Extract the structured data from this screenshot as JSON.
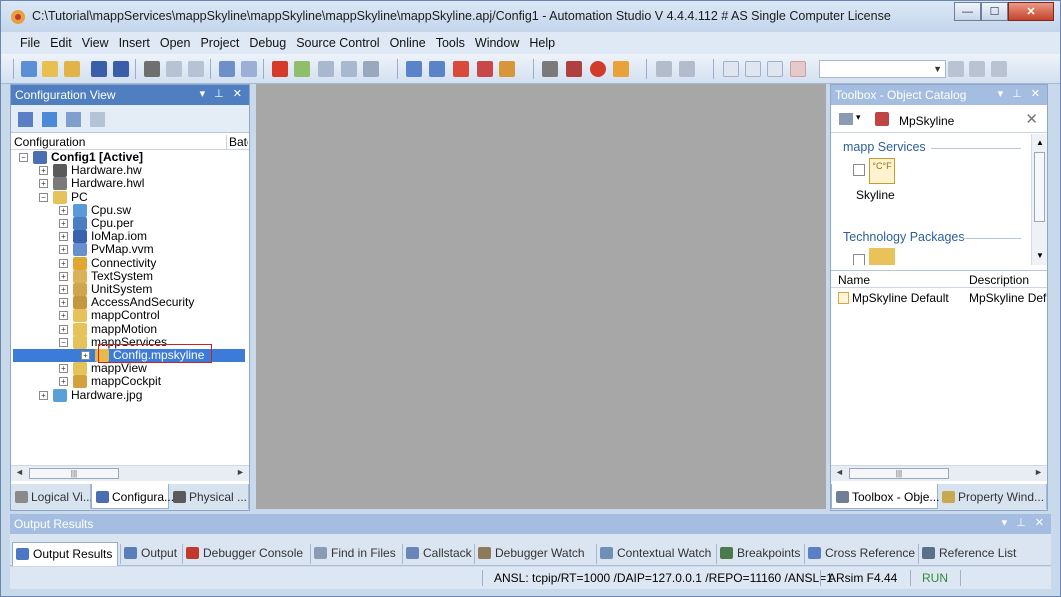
{
  "window": {
    "title": "C:\\Tutorial\\mappServices\\mappSkyline\\mappSkyline\\mappSkyline\\mappSkyline.apj/Config1 - Automation Studio V 4.4.4.112 # AS Single Computer License",
    "minimize": "—",
    "maximize": "☐",
    "close": "✕"
  },
  "menu": [
    "File",
    "Edit",
    "View",
    "Insert",
    "Open",
    "Project",
    "Debug",
    "Source Control",
    "Online",
    "Tools",
    "Window",
    "Help"
  ],
  "left_panel": {
    "title": "Configuration View",
    "title_buttons": "▾ ⊥ ✕",
    "col_configuration": "Configuration",
    "col_batch": "Batch",
    "tree": [
      {
        "label": "Config1 [Active]",
        "level": 0,
        "expander": "−",
        "bold": true,
        "icon": "config-icon",
        "color": "#4c6fb3"
      },
      {
        "label": "Hardware.hw",
        "level": 1,
        "expander": "+",
        "icon": "hardware-icon",
        "color": "#5a5a5a"
      },
      {
        "label": "Hardware.hwl",
        "level": 1,
        "expander": "+",
        "icon": "hardware-list-icon",
        "color": "#7a7a7a"
      },
      {
        "label": "PC",
        "level": 1,
        "expander": "−",
        "icon": "folder-icon",
        "color": "#e6c25a"
      },
      {
        "label": "Cpu.sw",
        "level": 2,
        "expander": "+",
        "icon": "cpu-sw-icon",
        "color": "#5a9ad8"
      },
      {
        "label": "Cpu.per",
        "level": 2,
        "expander": "+",
        "icon": "cpu-per-icon",
        "color": "#4a7fc2"
      },
      {
        "label": "IoMap.iom",
        "level": 2,
        "expander": "+",
        "icon": "iomap-icon",
        "color": "#3a62b0"
      },
      {
        "label": "PvMap.vvm",
        "level": 2,
        "expander": "+",
        "icon": "pvmap-icon",
        "color": "#6a8fcf"
      },
      {
        "label": "Connectivity",
        "level": 2,
        "expander": "+",
        "icon": "connectivity-icon",
        "color": "#e0a732"
      },
      {
        "label": "TextSystem",
        "level": 2,
        "expander": "+",
        "icon": "textsystem-icon",
        "color": "#d9b25a"
      },
      {
        "label": "UnitSystem",
        "level": 2,
        "expander": "+",
        "icon": "unitsystem-icon",
        "color": "#d2a44e"
      },
      {
        "label": "AccessAndSecurity",
        "level": 2,
        "expander": "+",
        "icon": "security-icon",
        "color": "#c8963e"
      },
      {
        "label": "mappControl",
        "level": 2,
        "expander": "+",
        "icon": "folder-icon",
        "color": "#e6c25a"
      },
      {
        "label": "mappMotion",
        "level": 2,
        "expander": "+",
        "icon": "folder-icon",
        "color": "#e6c25a"
      },
      {
        "label": "mappServices",
        "level": 2,
        "expander": "−",
        "icon": "folder-icon",
        "color": "#e6c25a"
      },
      {
        "label": "Config.mpskyline",
        "level": 3,
        "expander": "+",
        "icon": "mpskyline-file-icon",
        "color": "#e8b848",
        "selected": true
      },
      {
        "label": "mappView",
        "level": 2,
        "expander": "+",
        "icon": "folder-icon",
        "color": "#e6c25a"
      },
      {
        "label": "mappCockpit",
        "level": 2,
        "expander": "+",
        "icon": "cockpit-icon",
        "color": "#d4a13a"
      },
      {
        "label": "Hardware.jpg",
        "level": 1,
        "expander": "+",
        "icon": "image-file-icon",
        "color": "#5aa0d8"
      }
    ],
    "scroll_thumb": "|||",
    "tabs": [
      {
        "label": "Logical Vi...",
        "icon": "logical-view-icon",
        "active": false
      },
      {
        "label": "Configura...",
        "icon": "configuration-view-icon",
        "active": true
      },
      {
        "label": "Physical ...",
        "icon": "physical-view-icon",
        "active": false
      }
    ]
  },
  "right_panel": {
    "title": "Toolbox - Object Catalog",
    "title_buttons": "▾ ⊥ ✕",
    "search_value": "MpSkyline",
    "clear": "✕",
    "groups": [
      {
        "label": "mapp Services"
      },
      {
        "label": "Technology Packages"
      }
    ],
    "item_label": "Skyline",
    "item_icon_text": "°C°F",
    "list_col_name": "Name",
    "list_col_description": "Description",
    "list_row_name": "MpSkyline Default",
    "list_row_description": "MpSkyline Defa",
    "scroll_thumb": "|||",
    "tabs": [
      {
        "label": "Toolbox - Obje...",
        "icon": "toolbox-icon",
        "active": true
      },
      {
        "label": "Property Wind...",
        "icon": "property-window-icon",
        "active": false
      }
    ]
  },
  "output": {
    "title": "Output Results",
    "title_buttons": "▾ ⊥ ✕",
    "tabs": [
      {
        "label": "Output Results",
        "icon": "output-results-icon",
        "active": true
      },
      {
        "label": "Output",
        "icon": "output-icon"
      },
      {
        "label": "Debugger Console",
        "icon": "debugger-console-icon"
      },
      {
        "label": "Find in Files",
        "icon": "find-in-files-icon"
      },
      {
        "label": "Callstack",
        "icon": "callstack-icon"
      },
      {
        "label": "Debugger Watch",
        "icon": "debugger-watch-icon"
      },
      {
        "label": "Contextual Watch",
        "icon": "contextual-watch-icon"
      },
      {
        "label": "Breakpoints",
        "icon": "breakpoints-icon"
      },
      {
        "label": "Cross Reference",
        "icon": "cross-reference-icon"
      },
      {
        "label": "Reference List",
        "icon": "reference-list-icon"
      }
    ]
  },
  "status": {
    "connection": "ANSL: tcpip/RT=1000 /DAIP=127.0.0.1 /REPO=11160 /ANSL=1",
    "target": "ARsim  F4.44",
    "state": "RUN"
  },
  "colors": {
    "accent": "#4f7fc0",
    "selection": "#3d7bd9",
    "run": "#2e8b3a",
    "highlight_box": "#cc2222",
    "group_text": "#2e5f9b"
  }
}
